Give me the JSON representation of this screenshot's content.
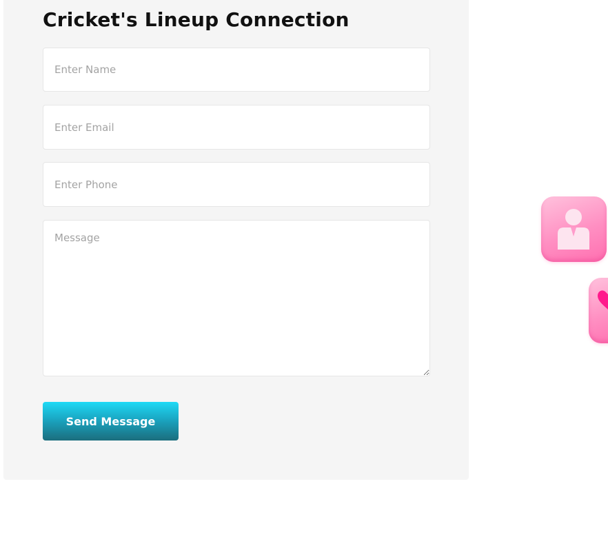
{
  "form": {
    "title": "Cricket's Lineup Connection",
    "name_placeholder": "Enter Name",
    "email_placeholder": "Enter Email",
    "phone_placeholder": "Enter Phone",
    "message_placeholder": "Message",
    "submit_label": "Send Message"
  },
  "side_icons": [
    {
      "icon": "person-icon",
      "color": "#ff8fc2"
    },
    {
      "icon": "heart-icon",
      "color": "#ff6fb0"
    }
  ],
  "colors": {
    "panel_bg": "#f5f5f5",
    "button_top": "#1fdaf6",
    "button_bottom": "#1b6d7d",
    "icon_pink": "#ff8fc2",
    "heart_pink": "#ff1a8c"
  }
}
